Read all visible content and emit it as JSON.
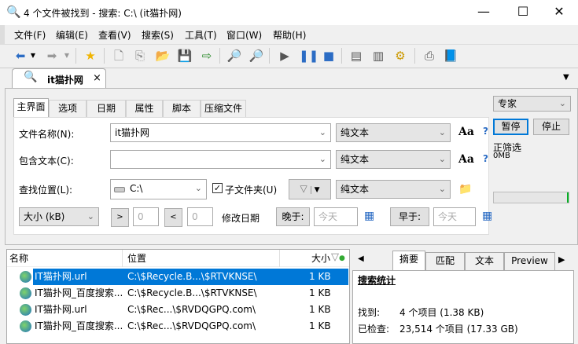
{
  "window": {
    "title": "4 个文件被找到 - 搜索: C:\\ (it猫扑网)",
    "minimize": "—",
    "maximize": "☐",
    "close": "✕"
  },
  "menu": [
    "文件(F)",
    "编辑(E)",
    "查看(V)",
    "搜索(S)",
    "工具(T)",
    "窗口(W)",
    "帮助(H)"
  ],
  "doc_tab": {
    "label": "it猫扑网",
    "close": "×"
  },
  "tab_overflow": "▼",
  "inner_tabs": [
    "主界面",
    "选项",
    "日期",
    "属性",
    "脚本",
    "压缩文件"
  ],
  "form": {
    "filename_label": "文件名称(N):",
    "filename_value": "it猫扑网",
    "filename_mode": "纯文本",
    "contains_label": "包含文本(C):",
    "contains_value": "",
    "contains_mode": "纯文本",
    "location_label": "查找位置(L):",
    "location_value": "C:\\",
    "subfolders_label": "子文件夹(U)",
    "subfolders_checked": true,
    "location_mode": "纯文本",
    "size_select": "大小 (kB)",
    "gt": ">",
    "gt_value": "0",
    "lt": "<",
    "lt_value": "0",
    "modified_label": "修改日期",
    "after_label": "晚于:",
    "after_placeholder": "今天",
    "before_label": "早于:",
    "before_placeholder": "今天",
    "case_label": "Aa",
    "help": "?"
  },
  "side": {
    "mode": "专家",
    "pause": "暂停",
    "stop": "停止",
    "status": "正筛选",
    "size": "0MB",
    "progress": 0.02
  },
  "results": {
    "columns": [
      "名称",
      "位置",
      "大小"
    ],
    "rows": [
      {
        "name": "IT猫扑网.url",
        "location": "C:\\$Recycle.B...\\$RTVKNSE\\",
        "size": "1 KB",
        "selected": true
      },
      {
        "name": "IT猫扑网_百度搜索...",
        "location": "C:\\$Recycle.B...\\$RTVKNSE\\",
        "size": "1 KB"
      },
      {
        "name": "IT猫扑网.url",
        "location": "C:\\$Rec...\\$RVDQGPQ.com\\",
        "size": "1 KB"
      },
      {
        "name": "IT猫扑网_百度搜索...",
        "location": "C:\\$Rec...\\$RVDQGPQ.com\\",
        "size": "1 KB"
      }
    ]
  },
  "preview": {
    "tabs": [
      "摘要",
      "匹配",
      "文本",
      "Preview"
    ],
    "prev": "◀",
    "next": "▶",
    "heading": "搜索统计",
    "found_label": "找到:",
    "found_value": "4 个项目 (1.38 KB)",
    "checked_label": "已检查:",
    "checked_value": "23,514 个项目 (17.33 GB)"
  },
  "colors": {
    "selection": "#0078d7",
    "progress": "#06b025"
  }
}
